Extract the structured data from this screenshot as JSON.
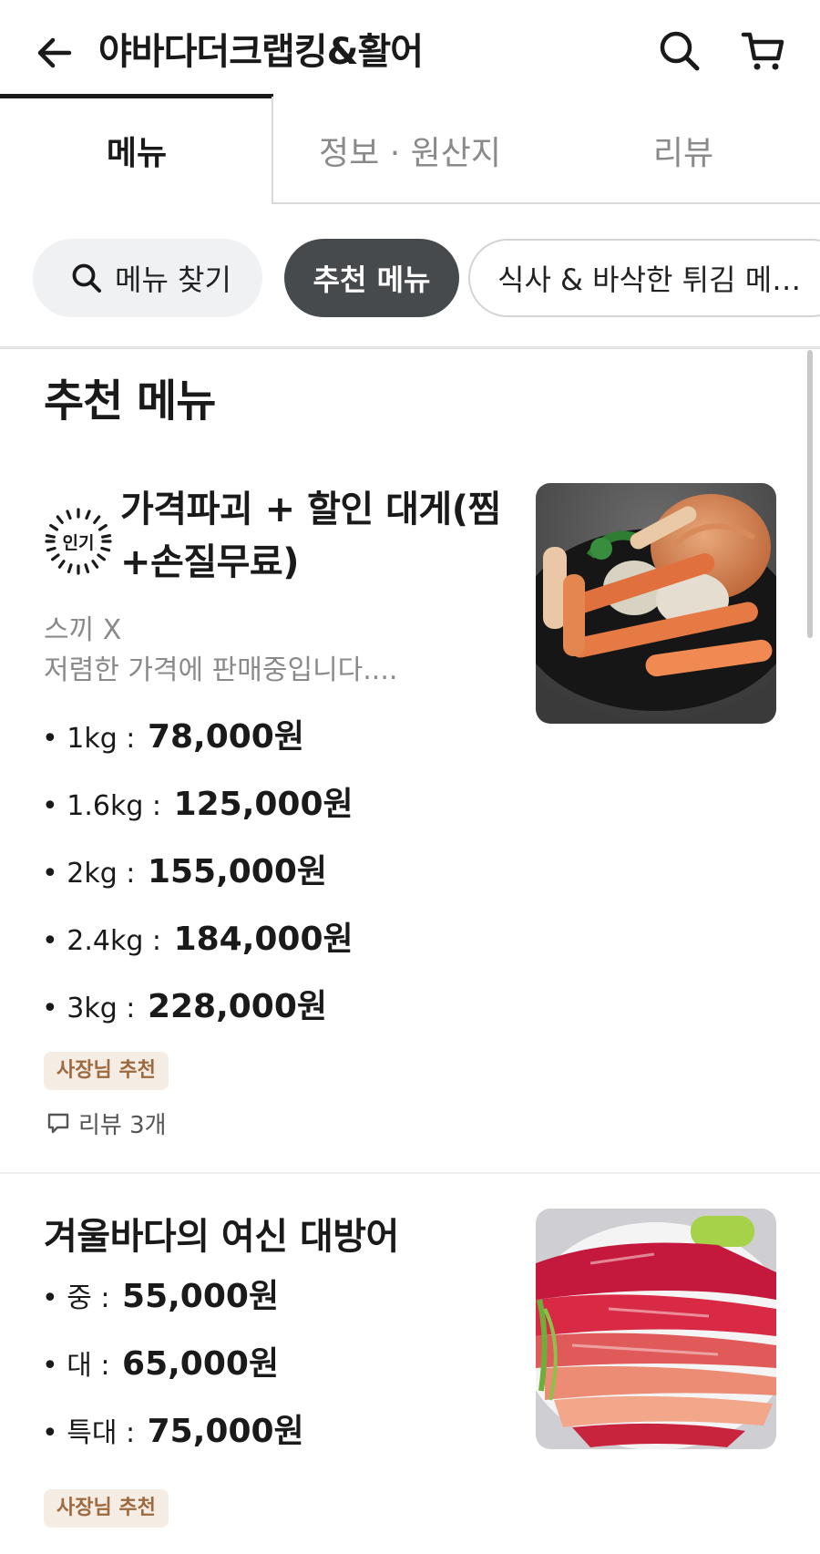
{
  "header": {
    "title": "야바다더크랩킹&활어",
    "back_icon": "back-arrow-icon",
    "search_icon": "search-icon",
    "cart_icon": "cart-icon"
  },
  "tabs": [
    {
      "label": "메뉴",
      "active": true
    },
    {
      "label": "정보 · 원산지",
      "active": false
    },
    {
      "label": "리뷰",
      "active": false
    }
  ],
  "chips": {
    "search_label": "메뉴 찾기",
    "recommended_label": "추천 메뉴",
    "meal_label": "식사 &  바삭한 튀김 메…"
  },
  "section": {
    "title": "추천 메뉴"
  },
  "items": [
    {
      "badge": "인기",
      "name": "가격파괴 + 할인 대게(찜 +손질무료)",
      "desc_line1": "스끼 X",
      "desc_line2": "저렴한 가격에 판매중입니다....",
      "prices": [
        {
          "label": "• 1kg :",
          "value": "78,000원"
        },
        {
          "label": "• 1.6kg :",
          "value": "125,000원"
        },
        {
          "label": "• 2kg :",
          "value": "155,000원"
        },
        {
          "label": "• 2.4kg :",
          "value": "184,000원"
        },
        {
          "label": "• 3kg :",
          "value": "228,000원"
        }
      ],
      "owner_badge": "사장님 추천",
      "review": "리뷰 3개"
    },
    {
      "name": "겨울바다의 여신 대방어",
      "prices": [
        {
          "label": "• 중 :",
          "value": "55,000원"
        },
        {
          "label": "• 대 :",
          "value": "65,000원"
        },
        {
          "label": "• 특대 :",
          "value": "75,000원"
        }
      ],
      "owner_badge": "사장님 추천"
    }
  ],
  "colors": {
    "chip_active_bg": "#474a4d",
    "badge_bg": "#f5ece3",
    "badge_text": "#9c6a3e"
  }
}
